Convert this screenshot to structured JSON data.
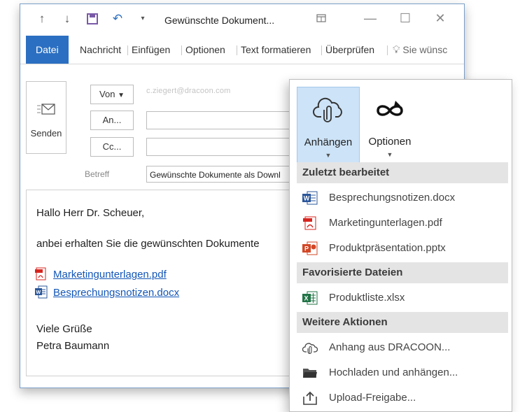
{
  "titlebar": {
    "title": "Gewünschte Dokument...",
    "icons": [
      "up-arrow-icon",
      "down-arrow-icon",
      "save-icon",
      "undo-icon",
      "customize-dropdown-icon",
      "restore-ribbon-icon",
      "minimize-icon",
      "maximize-icon",
      "close-icon"
    ]
  },
  "ribbon": {
    "tabs": [
      "Datei",
      "Nachricht",
      "Einfügen",
      "Optionen",
      "Text formatieren",
      "Überprüfen"
    ],
    "tell_me": "Sie wünsc"
  },
  "header": {
    "send_label": "Senden",
    "from_label": "Von",
    "to_label": "An...",
    "cc_label": "Cc...",
    "subject_label": "Betreff",
    "from_value": "c.ziegert@dracoon.com",
    "subject_value": "Gewünschte Dokumente als Downl"
  },
  "body": {
    "greeting": "Hallo Herr Dr. Scheuer,",
    "line": "anbei erhalten Sie die gewünschten Dokumente",
    "attachments": [
      "Marketingunterlagen.pdf",
      "Besprechungsnotizen.docx"
    ],
    "closing": "Viele Grüße",
    "signature": "Petra Baumann"
  },
  "panel": {
    "buttons": [
      {
        "label": "Anhängen",
        "icon": "cloud-attach-icon"
      },
      {
        "label": "Optionen",
        "icon": "infinity-refresh-icon"
      }
    ],
    "sections": [
      {
        "title": "Zuletzt bearbeitet",
        "items": [
          {
            "label": "Besprechungsnotizen.docx",
            "icon": "word-file-icon"
          },
          {
            "label": "Marketingunterlagen.pdf",
            "icon": "pdf-file-icon"
          },
          {
            "label": "Produktpräsentation.pptx",
            "icon": "powerpoint-file-icon"
          }
        ]
      },
      {
        "title": "Favorisierte Dateien",
        "items": [
          {
            "label": "Produktliste.xlsx",
            "icon": "excel-file-icon"
          }
        ]
      },
      {
        "title": "Weitere Aktionen",
        "items": [
          {
            "label": "Anhang aus DRACOON...",
            "icon": "cloud-attach-icon"
          },
          {
            "label": "Hochladen und anhängen...",
            "icon": "folder-icon"
          },
          {
            "label": "Upload-Freigabe...",
            "icon": "upload-share-icon"
          }
        ]
      }
    ]
  },
  "colors": {
    "accent": "#2b6fc2",
    "link": "#1356b8",
    "word": "#2b579a",
    "excel": "#217346",
    "powerpoint": "#d24726",
    "pdf": "#d7251f",
    "selected_button": "#cde3f7",
    "section_header": "#e4e4e4"
  }
}
